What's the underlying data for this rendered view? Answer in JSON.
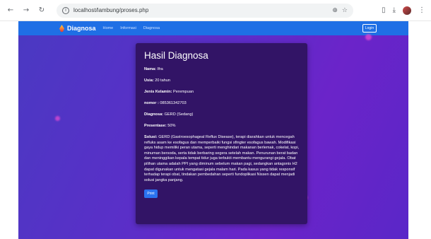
{
  "browser": {
    "url": "localhost/lambung/proses.php"
  },
  "nav": {
    "brand": "Diagnosa",
    "links": [
      "Home",
      "Informasi",
      "Diagnosa"
    ],
    "login_label": "Login"
  },
  "card": {
    "title": "Hasil Diagnosa",
    "fields": [
      {
        "label": "Nama:",
        "value": " Ifra"
      },
      {
        "label": "Usia:",
        "value": " 20 tahun"
      },
      {
        "label": "Jenis Kelamin:",
        "value": " Perempuan"
      },
      {
        "label": "nomor :",
        "value": " 085361342703"
      },
      {
        "label": "Diagnosa:",
        "value": " GERD (Sedang)"
      },
      {
        "label": "Presentase:",
        "value": " 50%"
      }
    ],
    "solusi_label": "Solusi:",
    "solusi_text": " GERD (Gastroesophageal Reflux Disease), terapi diarahkan untuk mencegah refluks asam ke esofagus dan memperbaiki fungsi sfingter esofagus bawah. Modifikasi gaya hidup memiliki peran utama, seperti menghindari makanan berlemak, cokelat, kopi, minuman bersoda, serta tidak berbaring segera setelah makan. Penurunan berat badan dan meninggikan kepala tempat tidur juga terbukti membantu mengurangi gejala. Obat pilihan utama adalah PPI yang diminum sebelum makan pagi, sedangkan antagonis H2 dapat digunakan untuk mengatasi gejala malam hari. Pada kasus yang tidak responsif terhadap terapi obat, tindakan pembedahan seperti fundoplikasi Nissen dapat menjadi solusi jangka panjang.",
    "print_label": "Print"
  },
  "colors": {
    "navbar": "#1f6fe5",
    "card": "#321466",
    "button": "#2a72f0",
    "particle": "#e34bd2"
  }
}
